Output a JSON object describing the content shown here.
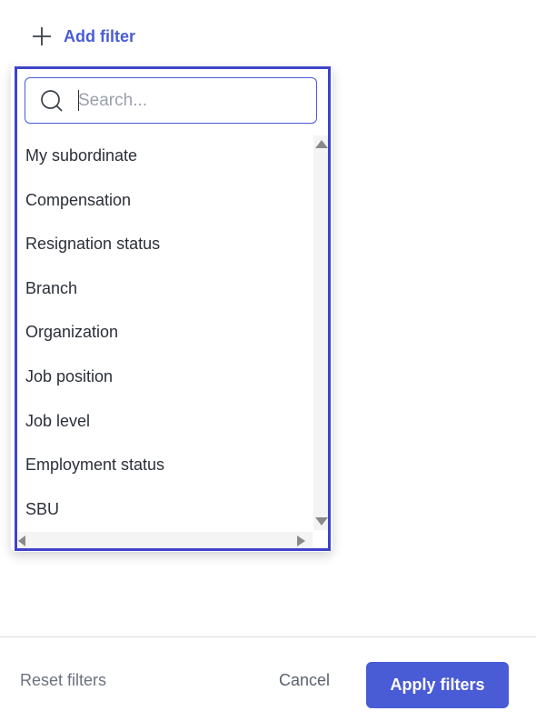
{
  "add_filter": {
    "label": "Add filter",
    "icon": "plus-icon"
  },
  "dropdown": {
    "search": {
      "placeholder": "Search...",
      "value": "",
      "icon": "search-icon"
    },
    "items": [
      {
        "label": "My subordinate"
      },
      {
        "label": "Compensation"
      },
      {
        "label": "Resignation status"
      },
      {
        "label": "Branch"
      },
      {
        "label": "Organization"
      },
      {
        "label": "Job position"
      },
      {
        "label": "Job level"
      },
      {
        "label": "Employment status"
      },
      {
        "label": "SBU"
      }
    ]
  },
  "footer": {
    "reset_label": "Reset filters",
    "cancel_label": "Cancel",
    "apply_label": "Apply filters"
  },
  "colors": {
    "accent": "#4a5bd6",
    "focus_ring": "#3d44c9",
    "text": "#2b2f38",
    "muted_text": "#6b7280"
  }
}
